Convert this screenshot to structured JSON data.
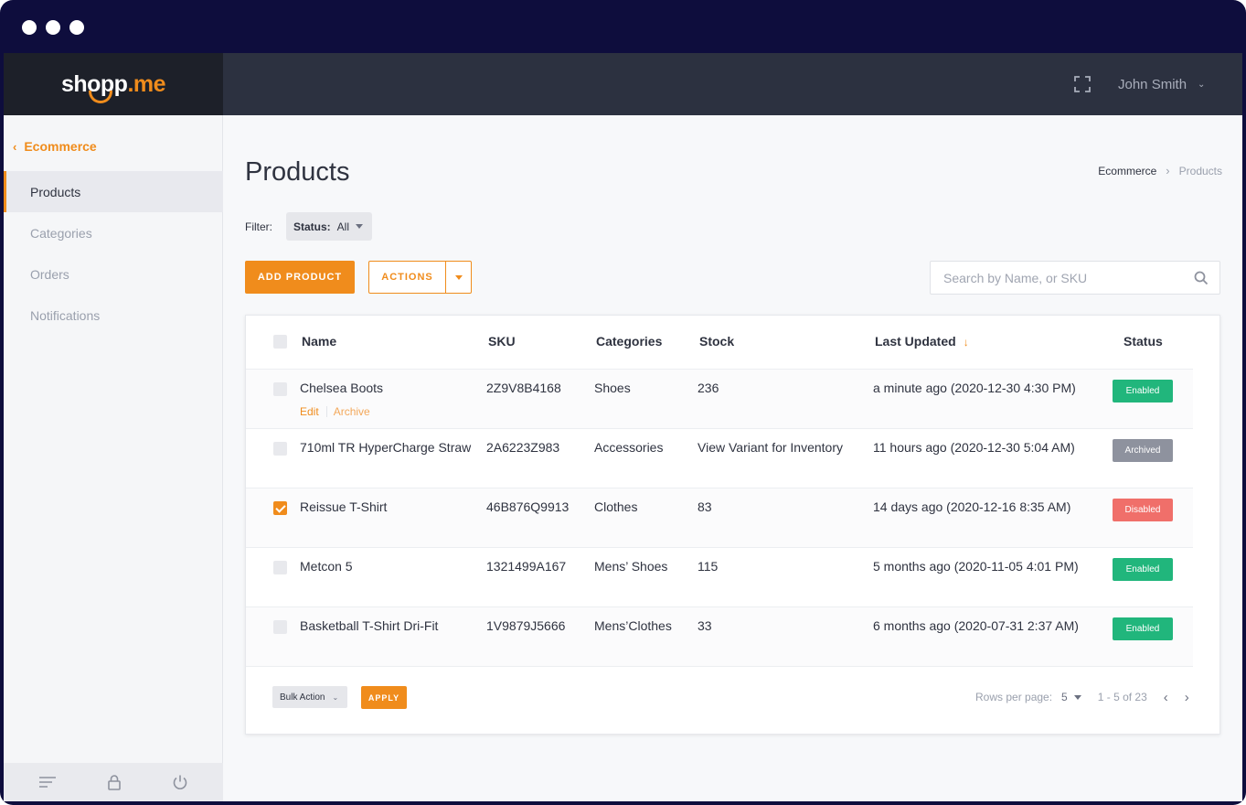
{
  "window": {
    "dots": 3
  },
  "brand": {
    "part1": "shopp",
    "part2": ".me"
  },
  "topbar": {
    "fullscreen_icon": "fullscreen-icon",
    "user_name": "John Smith"
  },
  "sidebar": {
    "back_label": "Ecommerce",
    "items": [
      {
        "label": "Products",
        "active": true
      },
      {
        "label": "Categories",
        "active": false
      },
      {
        "label": "Orders",
        "active": false
      },
      {
        "label": "Notifications",
        "active": false
      }
    ],
    "footer_icons": [
      "menu-lines-icon",
      "lock-icon",
      "power-icon"
    ]
  },
  "page": {
    "title": "Products",
    "breadcrumb": [
      "Ecommerce",
      "Products"
    ]
  },
  "filter": {
    "label": "Filter:",
    "status_key": "Status:",
    "status_value": "All"
  },
  "toolbar": {
    "add_label": "ADD PRODUCT",
    "actions_label": "ACTIONS",
    "search_placeholder": "Search by Name, or SKU"
  },
  "table": {
    "columns": [
      "Name",
      "SKU",
      "Categories",
      "Stock",
      "Last Updated",
      "Status"
    ],
    "sort_column": "Last Updated",
    "rows": [
      {
        "name": "Chelsea Boots",
        "sku": "2Z9V8B4168",
        "category": "Shoes",
        "stock": "236",
        "updated": "a minute ago (2020-12-30 4:30 PM)",
        "status": "Enabled",
        "checked": false,
        "edit": "Edit",
        "archive": "Archive"
      },
      {
        "name": "710ml TR HyperCharge Straw",
        "sku": "2A6223Z983",
        "category": "Accessories",
        "stock": "View Variant for Inventory",
        "updated": "11 hours ago (2020-12-30 5:04 AM)",
        "status": "Archived",
        "checked": false
      },
      {
        "name": "Reissue T-Shirt",
        "sku": "46B876Q9913",
        "category": "Clothes",
        "stock": "83",
        "updated": "14 days ago (2020-12-16 8:35 AM)",
        "status": "Disabled",
        "checked": true
      },
      {
        "name": "Metcon 5",
        "sku": "1321499A167",
        "category": "Mens’ Shoes",
        "stock": "115",
        "updated": "5 months ago (2020-11-05 4:01 PM)",
        "status": "Enabled",
        "checked": false
      },
      {
        "name": "Basketball T-Shirt Dri-Fit",
        "sku": "1V9879J5666",
        "category": "Mens’Clothes",
        "stock": "33",
        "updated": "6 months ago (2020-07-31 2:37 AM)",
        "status": "Enabled",
        "checked": false
      }
    ]
  },
  "footer": {
    "bulk_label": "Bulk Action",
    "apply_label": "APPLY",
    "rows_per_page_label": "Rows per page:",
    "rows_per_page_value": "5",
    "range": "1 - 5 of 23"
  },
  "colors": {
    "accent": "#f08c1c",
    "enabled": "#21b67c",
    "archived": "#8e929e",
    "disabled": "#f06f6a",
    "topbar": "#2c3140",
    "frame": "#0e0d3d"
  }
}
